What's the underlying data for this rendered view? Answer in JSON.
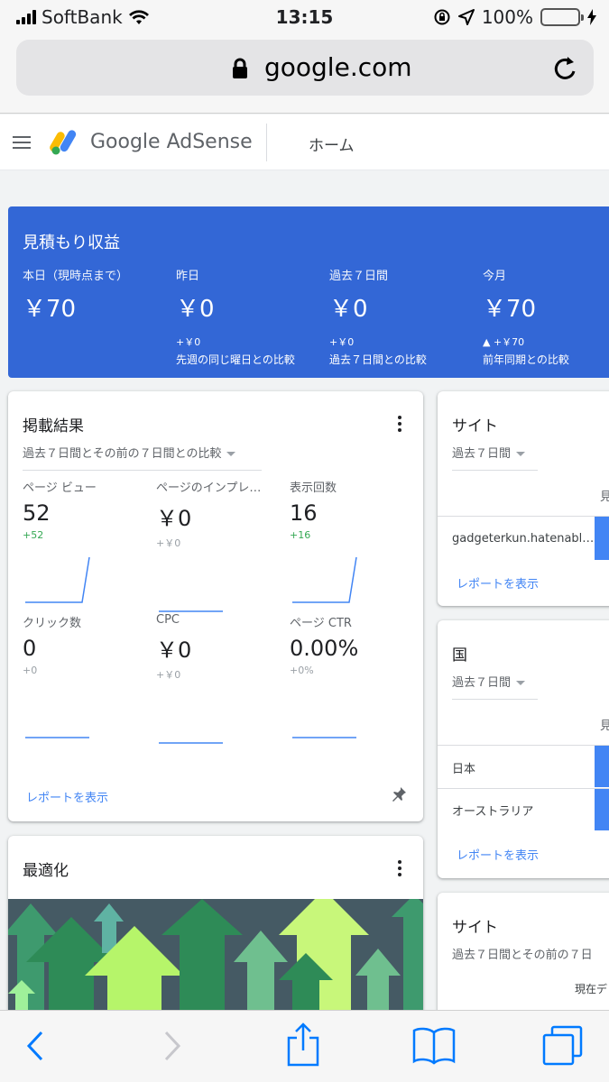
{
  "status": {
    "carrier": "SoftBank",
    "time": "13:15",
    "battery": "100%"
  },
  "browser": {
    "url": "google.com"
  },
  "app": {
    "brand": "Google AdSense",
    "nav_home": "ホーム"
  },
  "estimated": {
    "title": "見積もり収益",
    "columns": [
      {
        "label": "本日（現時点まで）",
        "value": "￥70",
        "delta": "",
        "compare": ""
      },
      {
        "label": "昨日",
        "value": "￥0",
        "delta": "+￥0",
        "compare": "先週の同じ曜日との比較"
      },
      {
        "label": "過去７日間",
        "value": "￥0",
        "delta": "+￥0",
        "compare": "過去７日間との比較"
      },
      {
        "label": "今月",
        "value": "￥70",
        "delta": "▲ +￥70",
        "compare": "前年同期との比較"
      }
    ]
  },
  "performance": {
    "title": "掲載結果",
    "range": "過去７日間とその前の７日間との比較",
    "metrics": [
      {
        "label": "ページ ビュー",
        "value": "52",
        "delta": "+52",
        "delta_color": "#34a853",
        "trend": "up"
      },
      {
        "label": "ページのインプレ…",
        "value": "￥0",
        "delta": "+￥0",
        "delta_color": "#9aa0a6",
        "trend": "flat"
      },
      {
        "label": "表示回数",
        "value": "16",
        "delta": "+16",
        "delta_color": "#34a853",
        "trend": "up"
      },
      {
        "label": "クリック数",
        "value": "0",
        "delta": "+0",
        "delta_color": "#9aa0a6",
        "trend": "flat"
      },
      {
        "label": "CPC",
        "value": "￥0",
        "delta": "+￥0",
        "delta_color": "#9aa0a6",
        "trend": "flat"
      },
      {
        "label": "ページ CTR",
        "value": "0.00%",
        "delta": "+0%",
        "delta_color": "#9aa0a6",
        "trend": "flat"
      }
    ],
    "report_link": "レポートを表示"
  },
  "optimization": {
    "title": "最適化"
  },
  "sites": {
    "title": "サイト",
    "range": "過去７日間",
    "column_header": "見",
    "rows": [
      "gadgeterkun.hatenabl…"
    ],
    "report_link": "レポートを表示"
  },
  "countries": {
    "title": "国",
    "range": "過去７日間",
    "column_header": "見",
    "rows": [
      "日本",
      "オーストラリア"
    ],
    "report_link": "レポートを表示"
  },
  "sites2": {
    "title": "サイト",
    "range": "過去７日間とその前の７日",
    "column_header": "現在デ"
  },
  "colors": {
    "accent": "#3367d6",
    "link": "#4285f4",
    "positive": "#34a853"
  }
}
